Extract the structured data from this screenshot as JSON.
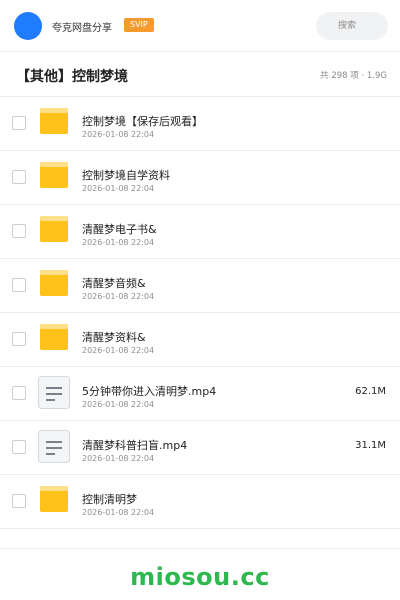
{
  "header": {
    "brand": "夸克网盘分享",
    "badge": "SVIP",
    "search_placeholder": "搜索"
  },
  "title_bar": {
    "title": "【其他】控制梦境",
    "count": "共 298 项 · 1.9G"
  },
  "items": [
    {
      "type": "folder",
      "name": "控制梦境【保存后观看】",
      "date": "2026-01-08 22:04",
      "size": ""
    },
    {
      "type": "folder",
      "name": "控制梦境自学资料",
      "date": "2026-01-08 22:04",
      "size": ""
    },
    {
      "type": "folder",
      "name": "清醒梦电子书&",
      "date": "2026-01-08 22:04",
      "size": ""
    },
    {
      "type": "folder",
      "name": "清醒梦音频&",
      "date": "2026-01-08 22:04",
      "size": ""
    },
    {
      "type": "folder",
      "name": "清醒梦资料&",
      "date": "2026-01-08 22:04",
      "size": ""
    },
    {
      "type": "file",
      "name": "5分钟带你进入清明梦.mp4",
      "date": "2026-01-08 22:04",
      "size": "62.1M"
    },
    {
      "type": "file",
      "name": "清醒梦科普扫盲.mp4",
      "date": "2026-01-08 22:04",
      "size": "31.1M"
    },
    {
      "type": "folder",
      "name": "控制清明梦",
      "date": "2026-01-08 22:04",
      "size": ""
    }
  ],
  "icons": {
    "folder": "folder-icon",
    "file": "document-icon"
  },
  "colors": {
    "accent": "#1f7bff",
    "badge": "#f59b2e",
    "folder": "#ffc21a",
    "watermark": "#2fb84f"
  },
  "watermark": "miosou.cc"
}
